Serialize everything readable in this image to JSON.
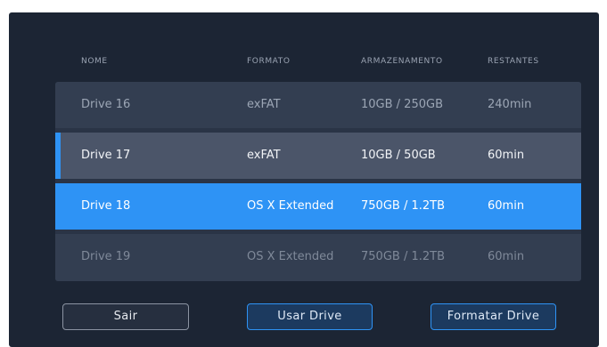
{
  "colors": {
    "panel_background": "#1c2534",
    "row_background": "#333e51",
    "row_current": "#4b5569",
    "accent_blue": "#2e93f5",
    "header_text": "#9aa3b2"
  },
  "table": {
    "columns": [
      "NOME",
      "FORMATO",
      "ARMAZENAMENTO",
      "RESTANTES"
    ],
    "rows": [
      {
        "name": "Drive 16",
        "format": "exFAT",
        "storage": "10GB / 250GB",
        "remaining": "240min",
        "state": "normal"
      },
      {
        "name": "Drive 17",
        "format": "exFAT",
        "storage": "10GB / 50GB",
        "remaining": "60min",
        "state": "current"
      },
      {
        "name": "Drive 18",
        "format": "OS X Extended",
        "storage": "750GB / 1.2TB",
        "remaining": "60min",
        "state": "selected"
      },
      {
        "name": "Drive 19",
        "format": "OS X Extended",
        "storage": "750GB / 1.2TB",
        "remaining": "60min",
        "state": "dimmed"
      }
    ]
  },
  "buttons": {
    "exit_label": "Sair",
    "use_label": "Usar Drive",
    "format_label": "Formatar Drive"
  }
}
